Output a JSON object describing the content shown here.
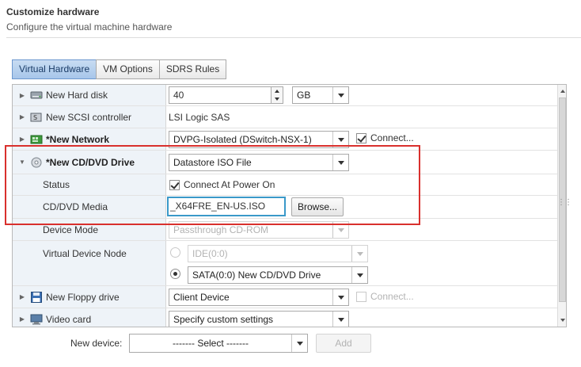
{
  "header": {
    "title": "Customize hardware",
    "subtitle": "Configure the virtual machine hardware"
  },
  "tabs": [
    {
      "label": "Virtual Hardware",
      "active": true
    },
    {
      "label": "VM Options",
      "active": false
    },
    {
      "label": "SDRS Rules",
      "active": false
    }
  ],
  "rows": {
    "hard_disk": {
      "label": "New Hard disk",
      "size_value": "40",
      "unit": "GB",
      "icon": "hard-disk-icon"
    },
    "scsi": {
      "label": "New SCSI controller",
      "value": "LSI Logic SAS",
      "icon": "scsi-controller-icon"
    },
    "network": {
      "label": "*New Network",
      "value": "DVPG-Isolated (DSwitch-NSX-1)",
      "connect_label": "Connect...",
      "connected": true,
      "icon": "network-adapter-icon"
    },
    "cdrom": {
      "label": "*New CD/DVD Drive",
      "value": "Datastore ISO File",
      "icon": "cd-dvd-icon",
      "status_label": "Status",
      "status_value": "Connect At Power On",
      "status_checked": true,
      "media_label": "CD/DVD Media",
      "media_value": "_X64FRE_EN-US.ISO",
      "browse_label": "Browse...",
      "device_mode_label": "Device Mode",
      "device_mode_value": "Passthrough CD-ROM",
      "vdn_label": "Virtual Device Node",
      "ide_option": "IDE(0:0)",
      "sata_option": "SATA(0:0) New CD/DVD Drive",
      "selected_node": "SATA"
    },
    "floppy": {
      "label": "New Floppy drive",
      "value": "Client Device",
      "connect_label": "Connect...",
      "icon": "floppy-icon"
    },
    "video": {
      "label": "Video card",
      "value": "Specify custom settings",
      "icon": "video-card-icon"
    }
  },
  "footer": {
    "new_device_label": "New device:",
    "new_device_value": "------- Select -------",
    "add_label": "Add"
  },
  "colors": {
    "accent": "#6d98cf",
    "highlight_red": "#d9302d",
    "highlight_blue": "#3a99c9",
    "row_label_bg": "#eef3f8"
  }
}
